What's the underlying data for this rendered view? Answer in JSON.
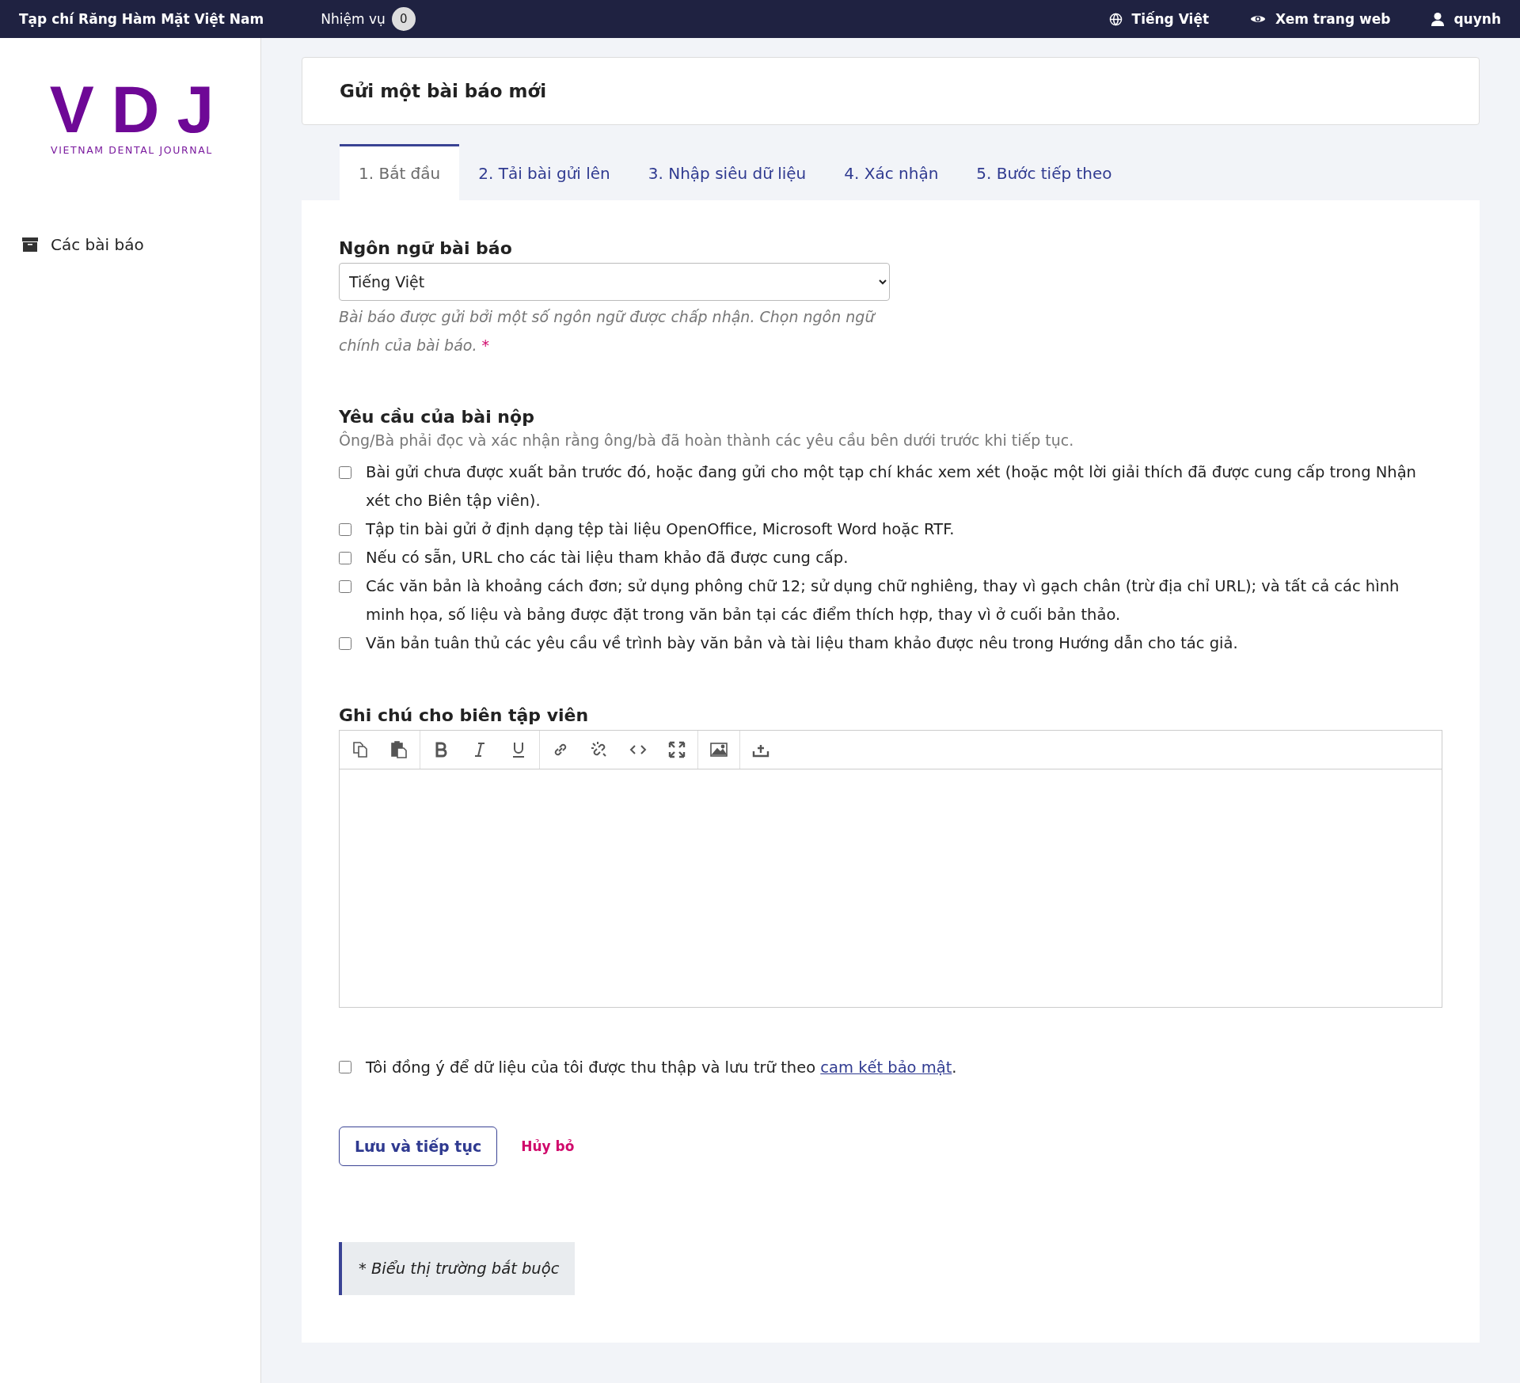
{
  "top_bar": {
    "site_title": "Tạp chí Răng Hàm Mặt Việt Nam",
    "tasks_label": "Nhiệm vụ",
    "tasks_count": "0",
    "language": "Tiếng Việt",
    "view_site": "Xem trang web",
    "user": "quynh"
  },
  "sidebar": {
    "logo": {
      "mark": "VDJ",
      "subtitle": "VIETNAM DENTAL JOURNAL"
    },
    "items": [
      {
        "label": "Các bài báo",
        "selected": false
      }
    ]
  },
  "page_title": "Gửi một bài báo mới",
  "tabs": [
    {
      "label": "1. Bắt đầu",
      "selected": true
    },
    {
      "label": "2. Tải bài gửi lên",
      "selected": false
    },
    {
      "label": "3. Nhập siêu dữ liệu",
      "selected": false
    },
    {
      "label": "4. Xác nhận",
      "selected": false
    },
    {
      "label": "5. Bước tiếp theo",
      "selected": false
    }
  ],
  "language_field": {
    "label": "Ngôn ngữ bài báo",
    "value": "Tiếng Việt",
    "hint": "Bài báo được gửi bởi một số ngôn ngữ được chấp nhận. Chọn ngôn ngữ chính của bài báo.",
    "required_mark": "*"
  },
  "requirements": {
    "title": "Yêu cầu của bài nộp",
    "description": "Ông/Bà phải đọc và xác nhận rằng ông/bà đã hoàn thành các yêu cầu bên dưới trước khi tiếp tục.",
    "items": [
      {
        "label": "Bài gửi chưa được xuất bản trước đó, hoặc đang gửi cho một tạp chí khác xem xét (hoặc một lời giải thích đã được cung cấp trong Nhận xét cho Biên tập viên).",
        "checked": false
      },
      {
        "label": "Tập tin bài gửi ở định dạng tệp tài liệu OpenOffice, Microsoft Word hoặc RTF.",
        "checked": false
      },
      {
        "label": "Nếu có sẵn, URL cho các tài liệu tham khảo đã được cung cấp.",
        "checked": false
      },
      {
        "label": "Các văn bản là khoảng cách đơn; sử dụng phông chữ 12; sử dụng chữ nghiêng, thay vì gạch chân (trừ địa chỉ URL); và tất cả các hình minh họa, số liệu và bảng được đặt trong văn bản tại các điểm thích hợp, thay vì ở cuối bản thảo.",
        "checked": false
      },
      {
        "label": "Văn bản tuân thủ các yêu cầu về trình bày văn bản và tài liệu tham khảo được nêu trong Hướng dẫn cho tác giả.",
        "checked": false
      }
    ]
  },
  "editor_notes": {
    "label": "Ghi chú cho biên tập viên"
  },
  "consent": {
    "checked": false,
    "text": "Tôi đồng ý để dữ liệu của tôi được thu thập và lưu trữ theo ",
    "link": "cam kết bảo mật",
    "text_after": "."
  },
  "buttons": {
    "save": "Lưu và tiếp tục",
    "cancel": "Hủy bỏ"
  },
  "footnote": "* Biểu thị trường bắt buộc"
}
